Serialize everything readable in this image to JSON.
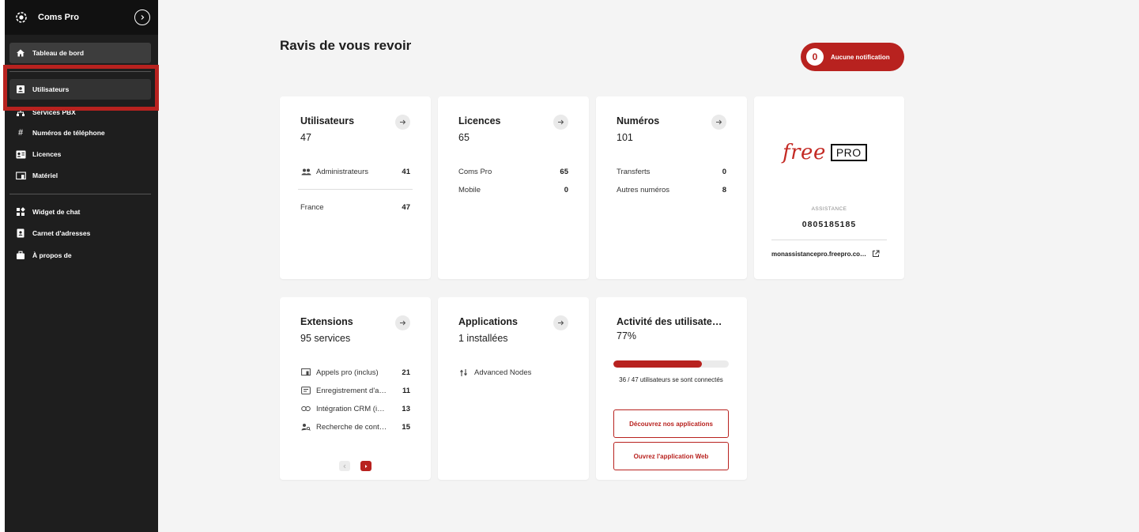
{
  "sidebar": {
    "brand": "Coms Pro",
    "items": [
      {
        "label": "Tableau de bord"
      },
      {
        "label": "Utilisateurs"
      },
      {
        "label": "Services PBX"
      },
      {
        "label": "Numéros de téléphone"
      },
      {
        "label": "Licences"
      },
      {
        "label": "Matériel"
      },
      {
        "label": "Widget de chat"
      },
      {
        "label": "Carnet d'adresses"
      },
      {
        "label": "À propos de"
      }
    ]
  },
  "header": {
    "greeting": "Ravis de vous revoir",
    "notif_count": "0",
    "notif_label": "Aucune notification"
  },
  "cards": {
    "users": {
      "title": "Utilisateurs",
      "value": "47",
      "rows": [
        {
          "label": "Administrateurs",
          "value": "41"
        },
        {
          "label": "France",
          "value": "47"
        }
      ]
    },
    "licences": {
      "title": "Licences",
      "value": "65",
      "rows": [
        {
          "label": "Coms Pro",
          "value": "65"
        },
        {
          "label": "Mobile",
          "value": "0"
        }
      ]
    },
    "numbers": {
      "title": "Numéros",
      "value": "101",
      "rows": [
        {
          "label": "Transferts",
          "value": "0"
        },
        {
          "label": "Autres numéros",
          "value": "8"
        }
      ]
    },
    "support": {
      "logo_main": "free",
      "logo_badge": "PRO",
      "label": "ASSISTANCE",
      "phone": "0805185185",
      "link": "monassistancepro.freepro.co…"
    },
    "extensions": {
      "title": "Extensions",
      "value": "95 services",
      "rows": [
        {
          "label": "Appels pro (inclus)",
          "value": "21"
        },
        {
          "label": "Enregistrement d'a…",
          "value": "11"
        },
        {
          "label": "Intégration CRM (i…",
          "value": "13"
        },
        {
          "label": "Recherche de cont…",
          "value": "15"
        }
      ]
    },
    "applications": {
      "title": "Applications",
      "value": "1 installées",
      "rows": [
        {
          "label": "Advanced Nodes"
        }
      ]
    },
    "activity": {
      "title": "Activité des utilisate…",
      "value": "77%",
      "progress": 0.77,
      "text": "36 / 47 utilisateurs se sont connectés",
      "btn1": "Découvrez nos applications",
      "btn2": "Ouvrez l'application Web"
    }
  },
  "colors": {
    "accent": "#b8221f",
    "sidebar_bg": "#1e1e1e",
    "page_bg": "#f4f4f4"
  }
}
